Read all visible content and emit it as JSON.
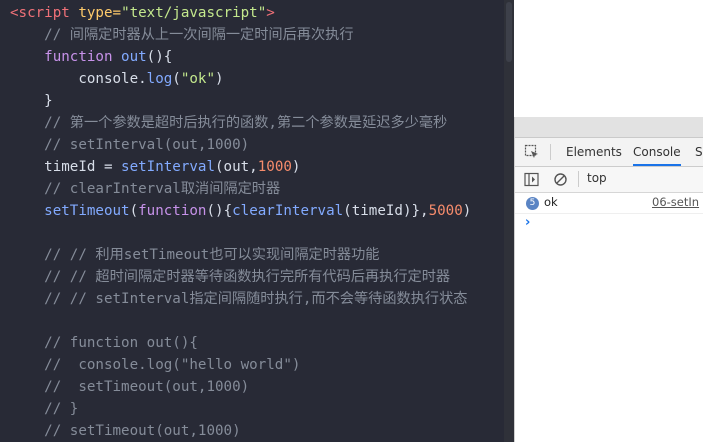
{
  "editor": {
    "lines": [
      [
        {
          "t": "<script ",
          "c": "tag"
        },
        {
          "t": "type=",
          "c": "attr"
        },
        {
          "t": "\"text/javascript\"",
          "c": "str"
        },
        {
          "t": ">",
          "c": "tag"
        }
      ],
      [
        {
          "t": "    // 间隔定时器从上一次间隔一定时间后再次执行",
          "c": "cm"
        }
      ],
      [
        {
          "t": "    function ",
          "c": "kw"
        },
        {
          "t": "out",
          "c": "fn"
        },
        {
          "t": "(){",
          "c": "plain"
        }
      ],
      [
        {
          "t": "        console.",
          "c": "plain"
        },
        {
          "t": "log",
          "c": "fn"
        },
        {
          "t": "(",
          "c": "plain"
        },
        {
          "t": "\"ok\"",
          "c": "str"
        },
        {
          "t": ")",
          "c": "plain"
        }
      ],
      [
        {
          "t": "    }",
          "c": "plain"
        }
      ],
      [
        {
          "t": "    // 第一个参数是超时后执行的函数,第二个参数是延迟多少毫秒",
          "c": "cm"
        }
      ],
      [
        {
          "t": "    // setInterval(out,1000)",
          "c": "cm"
        }
      ],
      [
        {
          "t": "    timeId = ",
          "c": "plain"
        },
        {
          "t": "setInterval",
          "c": "fn"
        },
        {
          "t": "(out,",
          "c": "plain"
        },
        {
          "t": "1000",
          "c": "num"
        },
        {
          "t": ")",
          "c": "plain"
        }
      ],
      [
        {
          "t": "    // clearInterval取消间隔定时器",
          "c": "cm"
        }
      ],
      [
        {
          "t": "    setTimeout",
          "c": "fn"
        },
        {
          "t": "(",
          "c": "plain"
        },
        {
          "t": "function",
          "c": "kw"
        },
        {
          "t": "(){",
          "c": "plain"
        },
        {
          "t": "clearInterval",
          "c": "fn"
        },
        {
          "t": "(timeId)},",
          "c": "plain"
        },
        {
          "t": "5000",
          "c": "num"
        },
        {
          "t": ")",
          "c": "plain"
        }
      ],
      [
        {
          "t": "",
          "c": "plain"
        }
      ],
      [
        {
          "t": "    // // 利用setTimeout也可以实现间隔定时器功能",
          "c": "cm"
        }
      ],
      [
        {
          "t": "    // // 超时间隔定时器等待函数执行完所有代码后再执行定时器",
          "c": "cm"
        }
      ],
      [
        {
          "t": "    // // setInterval指定间隔随时执行,而不会等待函数执行状态",
          "c": "cm"
        }
      ],
      [
        {
          "t": "",
          "c": "plain"
        }
      ],
      [
        {
          "t": "    // function out(){",
          "c": "cm"
        }
      ],
      [
        {
          "t": "    //  console.log(\"hello world\")",
          "c": "cm"
        }
      ],
      [
        {
          "t": "    //  setTimeout(out,1000)",
          "c": "cm"
        }
      ],
      [
        {
          "t": "    // }",
          "c": "cm"
        }
      ],
      [
        {
          "t": "    // setTimeout(out,1000)",
          "c": "cm"
        }
      ]
    ]
  },
  "devtools": {
    "tabs": [
      "Elements",
      "Console",
      "So"
    ],
    "active_tab": "Console",
    "context": "top",
    "console_rows": [
      {
        "count": "5",
        "message": "ok",
        "source": "06-setIn"
      }
    ],
    "prompt": "›",
    "accent": "#1a73e8"
  }
}
